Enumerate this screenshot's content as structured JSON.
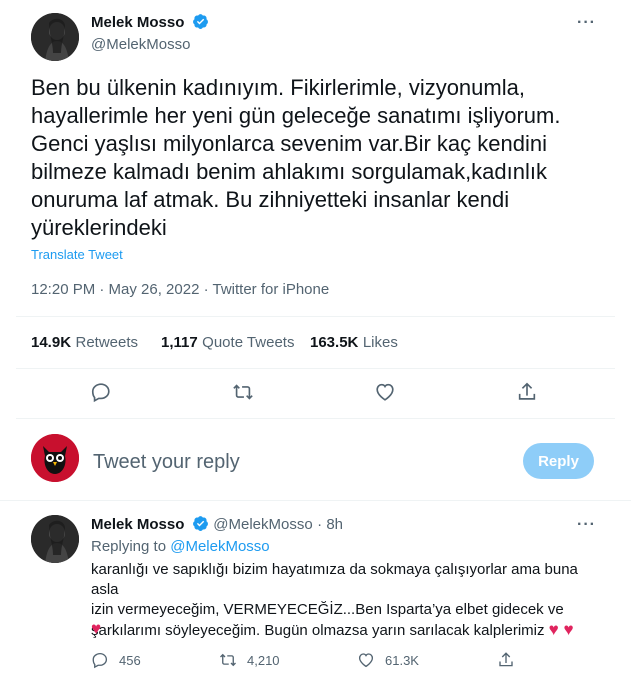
{
  "tweet": {
    "author_name": "Melek Mosso",
    "author_handle": "@MelekMosso",
    "text": "Ben bu ülkenin kadınıyım. Fikirlerimle, vizyonumla,\nhayallerimle her yeni gün geleceğe sanatımı işliyorum.\nGenci yaşlısı milyonlarca sevenim var.Bir kaç kendini\nbilmeze kalmadı benim ahlakımı sorgulamak,kadınlık\nonuruma laf atmak. Bu zihniyetteki insanlar kendi\nyüreklerindeki",
    "translate_label": "Translate Tweet",
    "timestamp": "12:20 PM · May 26, 2022 · Twitter for iPhone",
    "stats": {
      "retweets_count": "14.9K",
      "retweets_label": "Retweets",
      "quotes_count": "1,117",
      "quotes_label": "Quote Tweets",
      "likes_count": "163.5K",
      "likes_label": "Likes"
    }
  },
  "composer": {
    "placeholder": "Tweet your reply",
    "reply_button": "Reply"
  },
  "reply": {
    "author_name": "Melek Mosso",
    "author_handle": "@MelekMosso",
    "time": "· 8h",
    "replying_to_label": "Replying to",
    "replying_to_handle": "@MelekMosso",
    "text": "karanlığı ve sapıklığı bizim hayatımıza da sokmaya çalışıyorlar ama buna asla\nizin vermeyeceğim, VERMEYECEĞİZ...Ben Isparta’ya elbet gidecek ve\nşarkılarımı söyleyeceğim. Bugün olmazsa yarın sarılacak kalplerimiz",
    "hearts_inline": "♥ ♥",
    "heart_trailing": "♥",
    "counts": {
      "replies": "456",
      "retweets": "4,210",
      "likes": "61.3K"
    }
  },
  "colors": {
    "accent": "#1d9bf0",
    "reply_button_bg": "#8ecdf8",
    "secondary_text": "#536471",
    "divider": "#eff3f4",
    "heart": "#e0245e"
  },
  "icons": [
    "verified-badge-icon",
    "more-icon",
    "reply-icon",
    "retweet-icon",
    "like-icon",
    "share-icon",
    "owl-avatar-icon"
  ]
}
